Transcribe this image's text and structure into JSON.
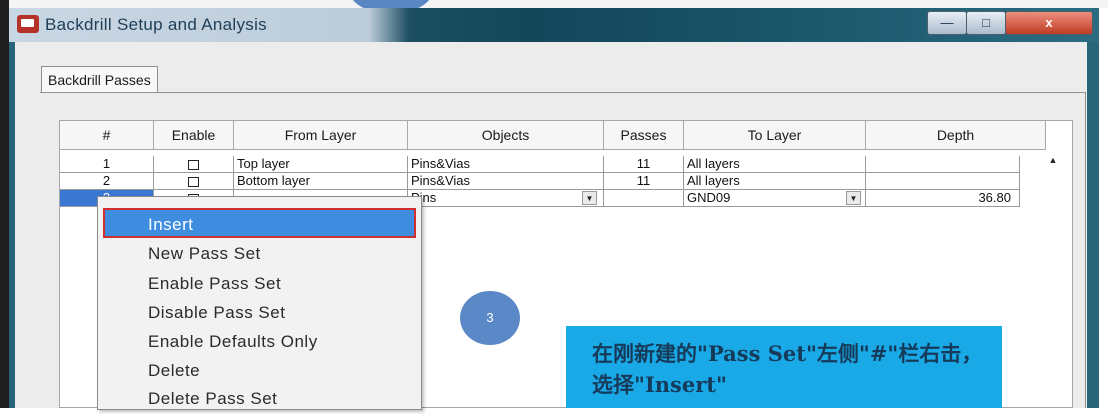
{
  "window": {
    "title": "Backdrill Setup and Analysis",
    "buttons": {
      "minimize": "—",
      "maximize": "□",
      "close": "x"
    }
  },
  "tab": {
    "label": "Backdrill Passes"
  },
  "table": {
    "headers": [
      "#",
      "Enable",
      "From Layer",
      "Objects",
      "Passes",
      "To Layer",
      "Depth"
    ],
    "rows": [
      {
        "num": "1",
        "from": "Top layer",
        "objects": "Pins&Vias",
        "passes": "11",
        "to": "All layers",
        "depth": ""
      },
      {
        "num": "2",
        "from": "Bottom layer",
        "objects": "Pins&Vias",
        "passes": "11",
        "to": "All layers",
        "depth": ""
      },
      {
        "num": "3",
        "from": "",
        "objects": "Pins",
        "passes": "",
        "to": "GND09",
        "depth": "36.80"
      }
    ]
  },
  "context_menu": {
    "items": [
      "Insert",
      "New Pass Set",
      "Enable Pass Set",
      "Disable Pass Set",
      "Enable Defaults Only",
      "Delete",
      "Delete Pass Set"
    ],
    "highlighted": "Insert"
  },
  "annotation": {
    "step": "3",
    "text": "在刚新建的\"Pass Set\"左侧\"#\"栏右击，选择\"Insert\""
  },
  "colors": {
    "note_bg": "#19a9e6",
    "highlight": "#3f8de0",
    "highlight_border": "#cf2f2f",
    "step_circle": "#5b88c6"
  }
}
